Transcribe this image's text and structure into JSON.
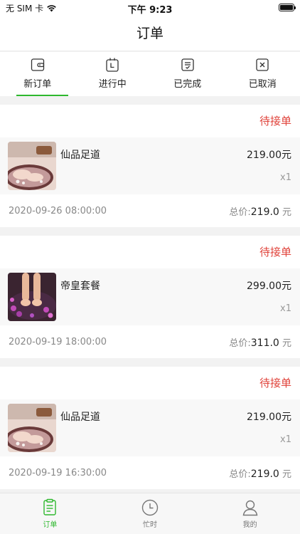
{
  "status_bar": {
    "carrier": "无 SIM 卡",
    "time": "下午 9:23",
    "battery_level": 1.0
  },
  "nav": {
    "title": "订单"
  },
  "tabs": [
    {
      "label": "新订单",
      "icon": "wallet-icon",
      "active": true
    },
    {
      "label": "进行中",
      "icon": "clock-box-icon",
      "active": false
    },
    {
      "label": "已完成",
      "icon": "check-box-icon",
      "active": false
    },
    {
      "label": "已取消",
      "icon": "x-box-icon",
      "active": false
    }
  ],
  "orders": [
    {
      "status": "待接单",
      "item_name": "仙品足道",
      "price": "219.00元",
      "qty": "x1",
      "time": "2020-09-26 08:00:00",
      "total_label": "总价:",
      "total_value": "219.0",
      "total_unit": "元"
    },
    {
      "status": "待接单",
      "item_name": "帝皇套餐",
      "price": "299.00元",
      "qty": "x1",
      "time": "2020-09-19 18:00:00",
      "total_label": "总价:",
      "total_value": "311.0",
      "total_unit": "元"
    },
    {
      "status": "待接单",
      "item_name": "仙品足道",
      "price": "219.00元",
      "qty": "x1",
      "time": "2020-09-19 16:30:00",
      "total_label": "总价:",
      "total_value": "219.0",
      "total_unit": "元"
    }
  ],
  "tabbar": [
    {
      "label": "订单",
      "icon": "order-list-icon",
      "active": true
    },
    {
      "label": "忙时",
      "icon": "clock-icon",
      "active": false
    },
    {
      "label": "我的",
      "icon": "user-icon",
      "active": false
    }
  ],
  "colors": {
    "accent_green": "#2eb82e",
    "status_red": "#e0433b"
  }
}
